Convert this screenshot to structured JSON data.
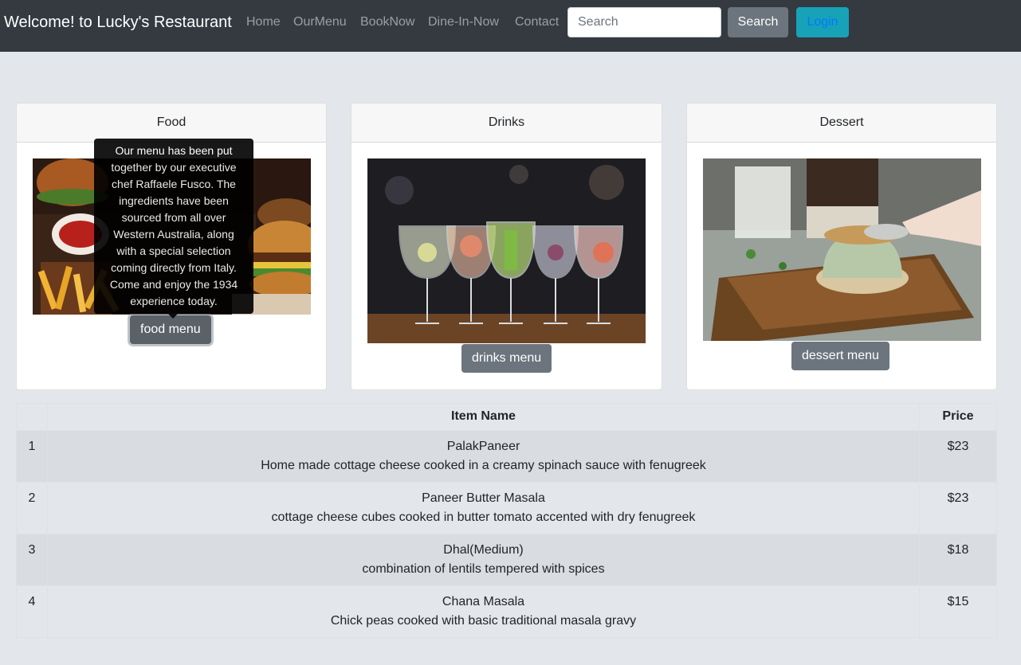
{
  "navbar": {
    "brand": "Welcome! to Lucky's Restaurant",
    "links": [
      "Home",
      "OurMenu",
      "BookNow",
      "Dine-In-Now",
      "Contact"
    ],
    "search_placeholder": "Search",
    "search_button": "Search",
    "login_button": "Login"
  },
  "cards": [
    {
      "title": "Food",
      "button": "food menu"
    },
    {
      "title": "Drinks",
      "button": "drinks menu"
    },
    {
      "title": "Dessert",
      "button": "dessert menu"
    }
  ],
  "tooltip": {
    "text": "Our menu has been put together by our executive chef Raffaele Fusco. The ingredients have been sourced from all over Western Australia, along with a special selection coming directly from Italy. Come and enjoy the 1934 experience today."
  },
  "table": {
    "headers": [
      "",
      "Item Name",
      "Price"
    ],
    "rows": [
      {
        "num": "1",
        "name": "PalakPaneer",
        "desc": "Home made cottage cheese cooked in a creamy spinach sauce with fenugreek",
        "price": "$23"
      },
      {
        "num": "2",
        "name": "Paneer Butter Masala",
        "desc": "cottage cheese cubes cooked in butter tomato accented with dry fenugreek",
        "price": "$23"
      },
      {
        "num": "3",
        "name": "Dhal(Medium)",
        "desc": "combination of lentils tempered with spices",
        "price": "$18"
      },
      {
        "num": "4",
        "name": "Chana Masala",
        "desc": "Chick peas cooked with basic traditional masala gravy",
        "price": "$15"
      }
    ]
  },
  "colors": {
    "navbar": "#343a40",
    "background": "#e3e7eb",
    "secondary": "#6c757d",
    "info": "#17a2b8"
  }
}
